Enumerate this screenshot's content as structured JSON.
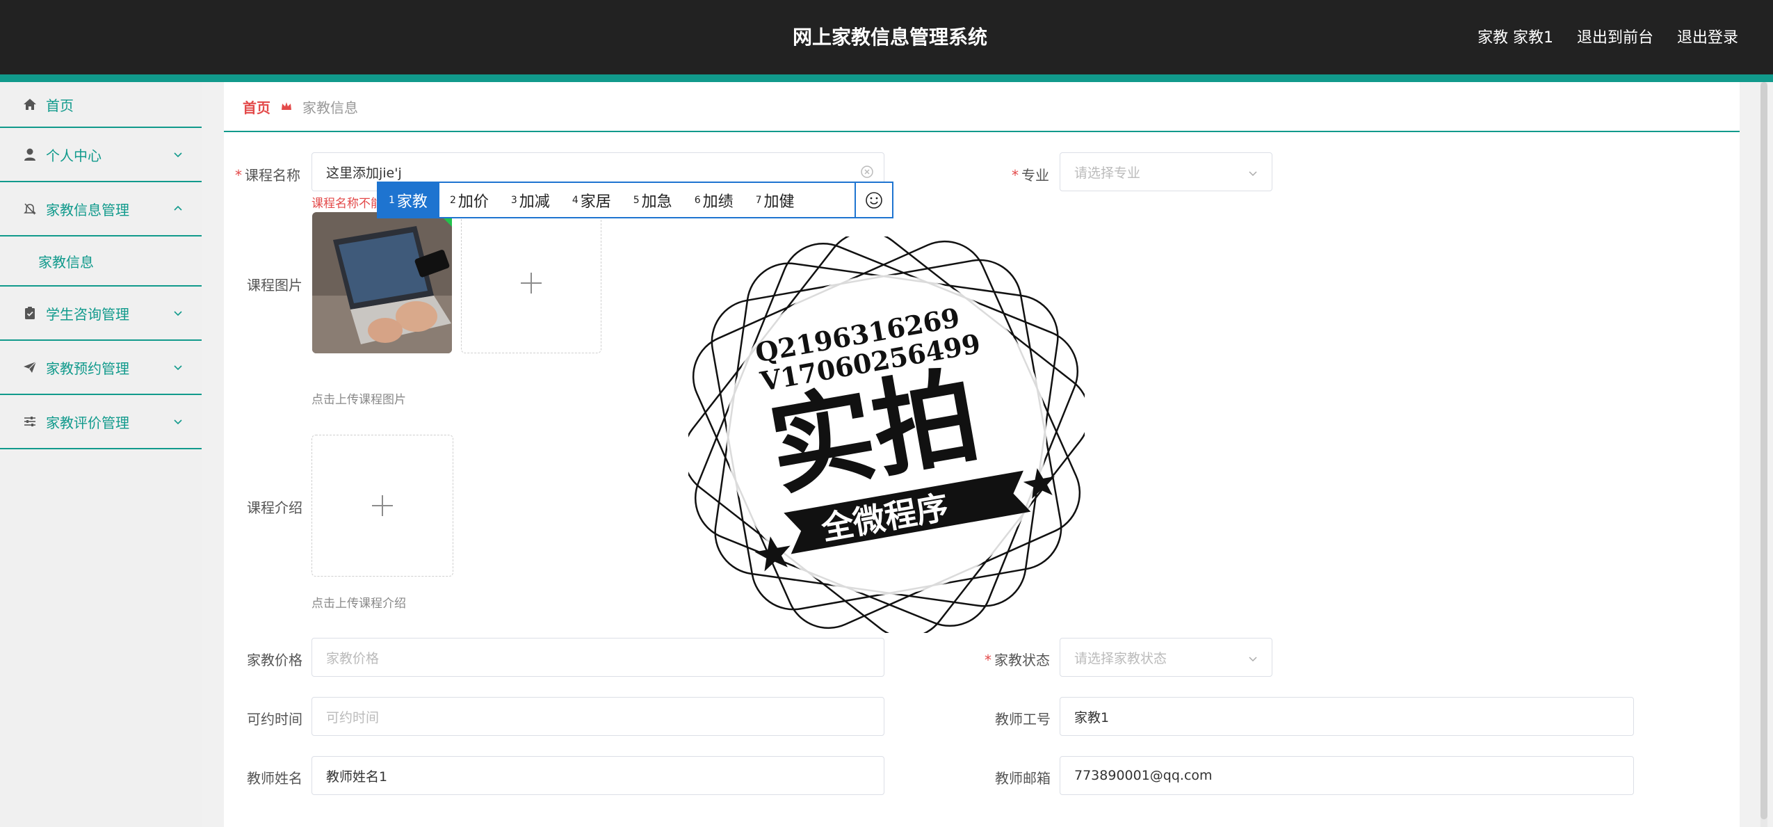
{
  "header": {
    "title": "网上家教信息管理系统",
    "user": "家教 家教1",
    "to_front": "退出到前台",
    "logout": "退出登录"
  },
  "sidebar": {
    "items": [
      {
        "label": "首页",
        "icon": "home-icon"
      },
      {
        "label": "个人中心",
        "icon": "user-icon"
      },
      {
        "label": "家教信息管理",
        "icon": "bell-off-icon",
        "expanded": true
      },
      {
        "label": "学生咨询管理",
        "icon": "clipboard-icon"
      },
      {
        "label": "家教预约管理",
        "icon": "send-icon"
      },
      {
        "label": "家教评价管理",
        "icon": "sliders-icon"
      }
    ],
    "subitem": "家教信息"
  },
  "breadcrumb": {
    "home": "首页",
    "current": "家教信息"
  },
  "form": {
    "course_name": {
      "label": "课程名称",
      "value": "这里添加jie'j",
      "error": "课程名称不能"
    },
    "major": {
      "label": "专业",
      "placeholder": "请选择专业"
    },
    "course_image": {
      "label": "课程图片",
      "hint": "点击上传课程图片"
    },
    "course_intro": {
      "label": "课程介绍",
      "hint": "点击上传课程介绍"
    },
    "price": {
      "label": "家教价格",
      "placeholder": "家教价格"
    },
    "status": {
      "label": "家教状态",
      "placeholder": "请选择家教状态"
    },
    "time": {
      "label": "可约时间",
      "placeholder": "可约时间"
    },
    "teacher_id": {
      "label": "教师工号",
      "value": "家教1"
    },
    "teacher_name": {
      "label": "教师姓名",
      "value": "教师姓名1"
    },
    "teacher_email": {
      "label": "教师邮箱",
      "value": "773890001@qq.com"
    }
  },
  "ime": {
    "candidates": [
      {
        "num": "1",
        "text": "家教"
      },
      {
        "num": "2",
        "text": "加价"
      },
      {
        "num": "3",
        "text": "加减"
      },
      {
        "num": "4",
        "text": "家居"
      },
      {
        "num": "5",
        "text": "加急"
      },
      {
        "num": "6",
        "text": "加绩"
      },
      {
        "num": "7",
        "text": "加健"
      }
    ]
  },
  "watermark": {
    "line1": "Q2196316269",
    "line2": "V17060256499",
    "main": "实拍",
    "ribbon": "全微程序"
  },
  "colors": {
    "accent": "#119a8c",
    "header": "#222222",
    "danger": "#e34a4a",
    "ime": "#1e74d0"
  }
}
